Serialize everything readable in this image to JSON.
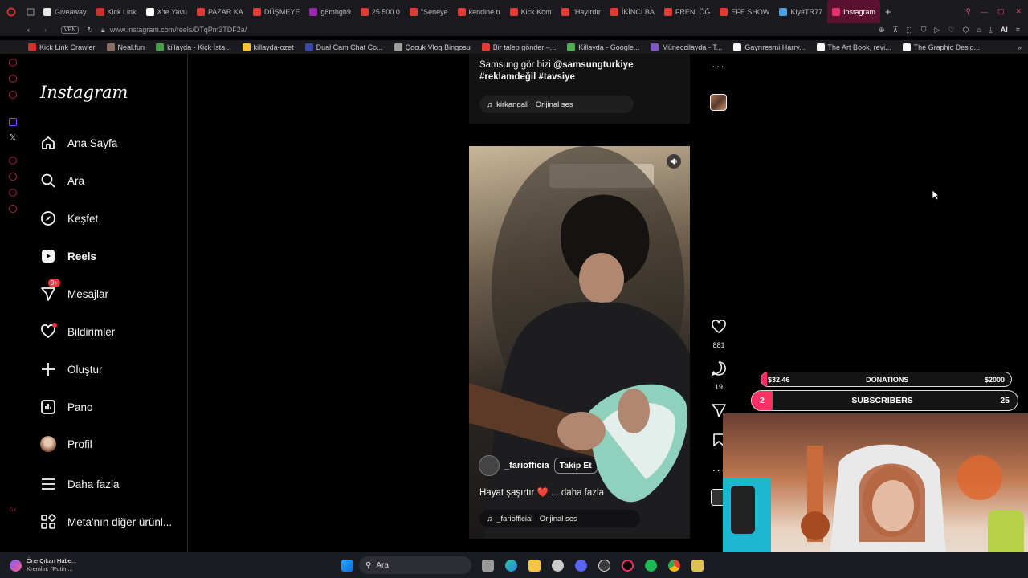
{
  "browser": {
    "tabs": [
      {
        "label": "Giveaway",
        "color": "#e5e5e5"
      },
      {
        "label": "Kick Link",
        "color": "#d32f2f"
      },
      {
        "label": "X'te Yavu",
        "color": "#ffffff"
      },
      {
        "label": "PAZAR KA",
        "color": "#e53935"
      },
      {
        "label": "DÜŞMEYE",
        "color": "#e53935"
      },
      {
        "label": "g8mhgh9",
        "color": "#9c27b0"
      },
      {
        "label": "25.500.0",
        "color": "#e53935"
      },
      {
        "label": "\"Seneye",
        "color": "#e53935"
      },
      {
        "label": "kendine tı",
        "color": "#e53935"
      },
      {
        "label": "Kick Kom",
        "color": "#e53935"
      },
      {
        "label": "\"Hayırdır",
        "color": "#e53935"
      },
      {
        "label": "İKİNCİ BA",
        "color": "#e53935"
      },
      {
        "label": "FRENİ ÖĞ",
        "color": "#e53935"
      },
      {
        "label": "EFE SHOW",
        "color": "#e53935"
      },
      {
        "label": "Kly#TR77",
        "color": "#4aa3df"
      },
      {
        "label": "Instagram",
        "color": "#e1306c"
      }
    ],
    "url": "www.instagram.com/reels/DTqPm3TDF2a/",
    "vpn": "VPN",
    "ai_label": "AI",
    "bookmarks": [
      {
        "label": "Kick Link Crawler",
        "color": "#d32f2f"
      },
      {
        "label": "Neal.fun",
        "color": "#8d6e63"
      },
      {
        "label": "killayda - Kick İsta...",
        "color": "#43a047"
      },
      {
        "label": "killayda-ozet",
        "color": "#fbc02d"
      },
      {
        "label": "Dual Cam Chat Co...",
        "color": "#3949ab"
      },
      {
        "label": "Çocuk Vlog Bingosu",
        "color": "#9e9e9e"
      },
      {
        "label": "Bir talep gönder –...",
        "color": "#e53935"
      },
      {
        "label": "Killayda - Google...",
        "color": "#4caf50"
      },
      {
        "label": "Müneccilayda - T...",
        "color": "#7e57c2"
      },
      {
        "label": "Gayrıresmi Harry...",
        "color": "#fafafa"
      },
      {
        "label": "The Art Book, revi...",
        "color": "#fafafa"
      },
      {
        "label": "The Graphic Desig...",
        "color": "#fafafa"
      }
    ]
  },
  "sidebar": {
    "logo": "Instagram",
    "items": [
      {
        "label": "Ana Sayfa",
        "icon": "home-icon"
      },
      {
        "label": "Ara",
        "icon": "search-icon"
      },
      {
        "label": "Keşfet",
        "icon": "compass-icon"
      },
      {
        "label": "Reels",
        "icon": "reels-icon"
      },
      {
        "label": "Mesajlar",
        "icon": "messenger-icon"
      },
      {
        "label": "Bildirimler",
        "icon": "heart-icon"
      },
      {
        "label": "Oluştur",
        "icon": "plus-icon"
      },
      {
        "label": "Pano",
        "icon": "dashboard-icon"
      },
      {
        "label": "Profil",
        "icon": "avatar"
      },
      {
        "label": "Daha fazla",
        "icon": "menu-icon"
      },
      {
        "label": "Meta'nın diğer ürünl...",
        "icon": "meta-apps-icon"
      }
    ],
    "messages_badge": "9+"
  },
  "reel_prev": {
    "caption_text": "Samsung gör bizi",
    "mention": "@samsungturkiye",
    "hashtags": "#reklamdeğil #tavsiye",
    "audio": "kirkangali · Orijinal ses"
  },
  "reel": {
    "username": "_fariofficia",
    "follow_label": "Takip Et",
    "caption": "Hayat şaşırtır",
    "caption_emoji": "❤️",
    "more_label": "... daha fazla",
    "audio": "_fariofficial · Orijinal ses"
  },
  "actions": {
    "likes": "881",
    "comments": "19"
  },
  "overlay": {
    "donations_current": "$32,46",
    "donations_label": "DONATIONS",
    "donations_goal": "$2000",
    "subs_current": "2",
    "subs_label": "SUBSCRIBERS",
    "subs_goal": "25"
  },
  "taskbar": {
    "news_title": "Öne Çıkan Habe...",
    "news_subtitle": "Kremlin: \"Putin,...",
    "search_placeholder": "Ara"
  },
  "operaside_label": "GX",
  "colors": {
    "accent": "#ff3040",
    "opera": "#c0204a",
    "bg": "#000000"
  }
}
